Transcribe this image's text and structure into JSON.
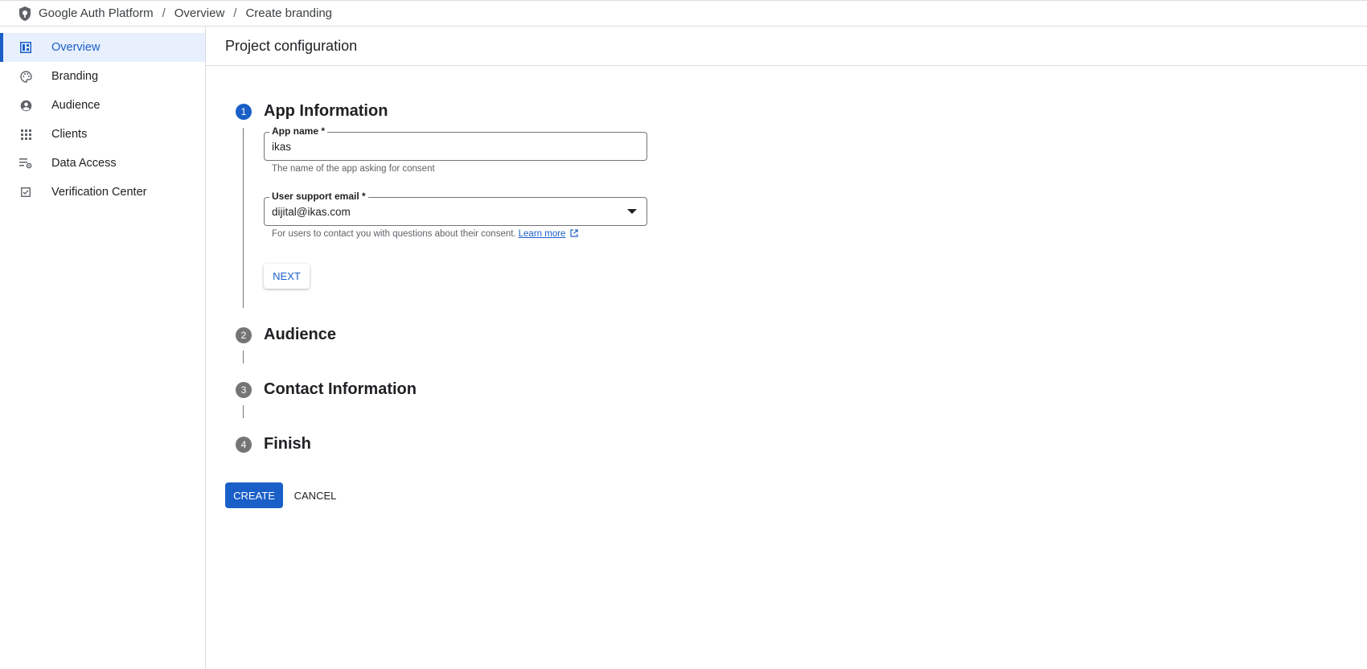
{
  "breadcrumb": {
    "items": [
      "Google Auth Platform",
      "Overview",
      "Create branding"
    ],
    "separator": "/"
  },
  "sidebar": {
    "items": [
      {
        "label": "Overview",
        "icon": "dashboard-icon",
        "active": true
      },
      {
        "label": "Branding",
        "icon": "palette-icon",
        "active": false
      },
      {
        "label": "Audience",
        "icon": "account-circle-icon",
        "active": false
      },
      {
        "label": "Clients",
        "icon": "apps-grid-icon",
        "active": false
      },
      {
        "label": "Data Access",
        "icon": "list-settings-icon",
        "active": false
      },
      {
        "label": "Verification Center",
        "icon": "checkbox-icon",
        "active": false
      }
    ]
  },
  "page": {
    "title": "Project configuration"
  },
  "steps": [
    {
      "number": "1",
      "title": "App Information",
      "active": true
    },
    {
      "number": "2",
      "title": "Audience",
      "active": false
    },
    {
      "number": "3",
      "title": "Contact Information",
      "active": false
    },
    {
      "number": "4",
      "title": "Finish",
      "active": false
    }
  ],
  "form": {
    "app_name": {
      "label": "App name *",
      "value": "ikas",
      "hint": "The name of the app asking for consent"
    },
    "support_email": {
      "label": "User support email *",
      "value": "dijital@ikas.com",
      "hint": "For users to contact you with questions about their consent.",
      "link": "Learn more"
    },
    "next_label": "NEXT"
  },
  "actions": {
    "create_label": "CREATE",
    "cancel_label": "CANCEL"
  },
  "colors": {
    "accent": "#1a5fc7",
    "active_bg": "#e8f0fe",
    "inactive_step": "#757575"
  }
}
